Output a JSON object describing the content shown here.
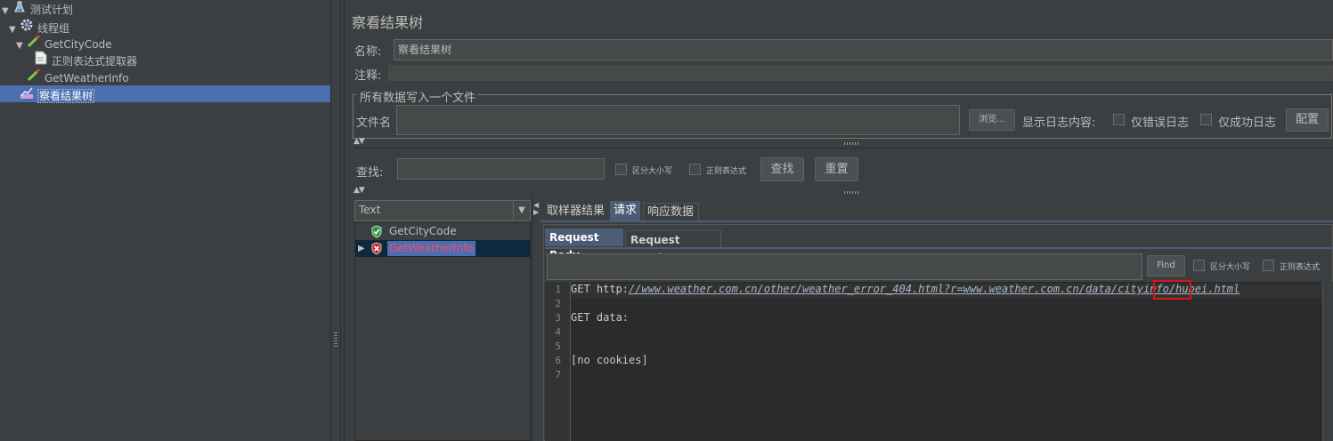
{
  "tree": {
    "items": [
      {
        "label": "测试计划",
        "icon": "flask-icon",
        "expanded": true
      },
      {
        "label": "线程组",
        "icon": "gear-icon",
        "expanded": true
      },
      {
        "label": "GetCityCode",
        "icon": "pipette-icon",
        "expanded": true
      },
      {
        "label": "正则表达式提取器",
        "icon": "document-icon"
      },
      {
        "label": "GetWeatherInfo",
        "icon": "pipette-icon"
      },
      {
        "label": "察看结果树",
        "icon": "graph-icon",
        "selected": true
      }
    ]
  },
  "panel": {
    "title": "察看结果树",
    "name_label": "名称:",
    "name_value": "察看结果树",
    "comment_label": "注释:",
    "comment_value": "",
    "file_group_title": "所有数据写入一个文件",
    "filename_label": "文件名",
    "filename_value": "",
    "browse_button": "浏览...",
    "log_content_label": "显示日志内容:",
    "errors_only_label": "仅错误日志",
    "success_only_label": "仅成功日志",
    "configure_button": "配置"
  },
  "search": {
    "label": "查找:",
    "value": "",
    "case_label": "区分大小写",
    "regex_label": "正则表达式",
    "find_button": "查找",
    "reset_button": "重置"
  },
  "results": {
    "renderer": "Text",
    "items": [
      {
        "label": "GetCityCode",
        "status": "success",
        "icon": "shield-check-icon"
      },
      {
        "label": "GetWeatherInfo",
        "status": "error",
        "icon": "shield-error-icon",
        "selected": true
      }
    ]
  },
  "tabs": {
    "items": [
      "取样器结果",
      "请求",
      "响应数据"
    ],
    "active": "请求"
  },
  "subtabs": {
    "items": [
      "Request Body",
      "Request Headers"
    ],
    "active": "Request Body"
  },
  "request_search": {
    "value": "",
    "find_button": "Find",
    "case_label": "区分大小写",
    "regex_label": "正则表达式"
  },
  "editor": {
    "lines": [
      {
        "num": "1",
        "prefix": "GET http:",
        "url": "//www.weather.com.cn/other/weather_error_404.html?r=www.weather.com.cn/data/cityinfo/hubei.html"
      },
      {
        "num": "2",
        "text": ""
      },
      {
        "num": "3",
        "text": "GET data:"
      },
      {
        "num": "4",
        "text": ""
      },
      {
        "num": "5",
        "text": ""
      },
      {
        "num": "6",
        "text": "[no cookies]"
      },
      {
        "num": "7",
        "text": ""
      }
    ],
    "highlight_term": "hubei",
    "highlight_color": "#e0121b"
  },
  "colors": {
    "background": "#3c3f41",
    "editor_background": "#2b2b2b",
    "selection": "#4b6eaf",
    "active_tab": "#4b5c75",
    "error_text": "#ff4a6d"
  }
}
